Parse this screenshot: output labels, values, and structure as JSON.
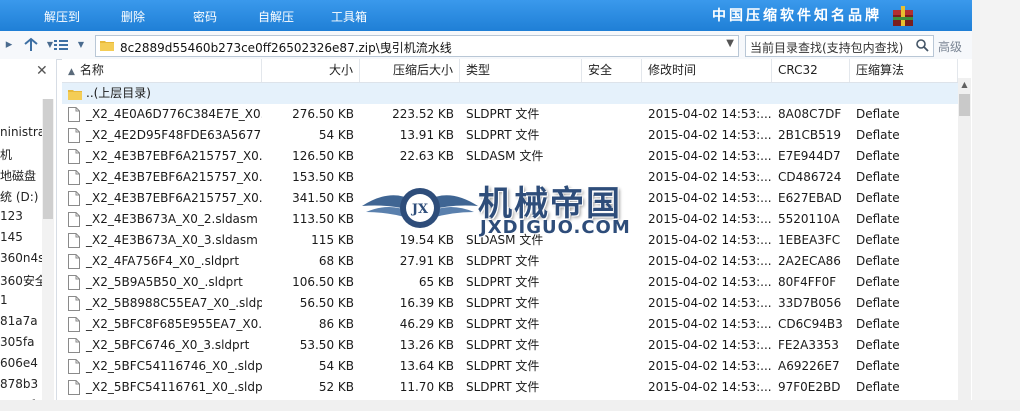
{
  "toolbar": {
    "buttons": [
      "解压到",
      "删除",
      "密码",
      "自解压",
      "工具箱"
    ],
    "brand": "中国压缩软件知名品牌"
  },
  "address": {
    "path": "8c2889d55460b273ce0ff26502326e87.zip\\曳引机流水线",
    "search_placeholder": "当前目录查找(支持包内查找)",
    "advanced": "高级"
  },
  "tree": {
    "items": [
      "ninistrat",
      "机",
      "地磁盘",
      "统 (D:)",
      "123",
      "145",
      "360n4s",
      "360安全",
      "1",
      "81a7a",
      "305fa",
      "606e4",
      "878b3",
      "9898f"
    ]
  },
  "columns": {
    "name": "名称",
    "size": "大小",
    "packed": "压缩后大小",
    "type": "类型",
    "security": "安全",
    "modified": "修改时间",
    "crc": "CRC32",
    "method": "压缩算法"
  },
  "parent_row": "..(上层目录)",
  "files": [
    {
      "name": "_X2_4E0A6D776C384E7E_X0...",
      "size": "276.50 KB",
      "packed": "223.52 KB",
      "type": "SLDPRT 文件",
      "modified": "2015-04-02 14:53:...",
      "crc": "8A08C7DF",
      "method": "Deflate"
    },
    {
      "name": "_X2_4E2D95F48FDE63A5677...",
      "size": "54 KB",
      "packed": "13.91 KB",
      "type": "SLDPRT 文件",
      "modified": "2015-04-02 14:53:...",
      "crc": "2B1CB519",
      "method": "Deflate"
    },
    {
      "name": "_X2_4E3B7EBF6A215757_X0...",
      "size": "126.50 KB",
      "packed": "22.63 KB",
      "type": "SLDASM 文件",
      "modified": "2015-04-02 14:53:...",
      "crc": "E7E944D7",
      "method": "Deflate"
    },
    {
      "name": "_X2_4E3B7EBF6A215757_X0...",
      "size": "153.50 KB",
      "packed": "",
      "type": "",
      "modified": "2015-04-02 14:53:...",
      "crc": "CD486724",
      "method": "Deflate"
    },
    {
      "name": "_X2_4E3B7EBF6A215757_X0...",
      "size": "341.50 KB",
      "packed": "",
      "type": "",
      "modified": "2015-04-02 14:53:...",
      "crc": "E627EBAD",
      "method": "Deflate"
    },
    {
      "name": "_X2_4E3B673A_X0_2.sldasm",
      "size": "113.50 KB",
      "packed": "",
      "type": "",
      "modified": "2015-04-02 14:53:...",
      "crc": "5520110A",
      "method": "Deflate"
    },
    {
      "name": "_X2_4E3B673A_X0_3.sldasm",
      "size": "115 KB",
      "packed": "19.54 KB",
      "type": "SLDASM 文件",
      "modified": "2015-04-02 14:53:...",
      "crc": "1EBEA3FC",
      "method": "Deflate"
    },
    {
      "name": "_X2_4FA756F4_X0_.sldprt",
      "size": "68 KB",
      "packed": "27.91 KB",
      "type": "SLDPRT 文件",
      "modified": "2015-04-02 14:53:...",
      "crc": "2A2ECA86",
      "method": "Deflate"
    },
    {
      "name": "_X2_5B9A5B50_X0_.sldprt",
      "size": "106.50 KB",
      "packed": "65 KB",
      "type": "SLDPRT 文件",
      "modified": "2015-04-02 14:53:...",
      "crc": "80F4FF0F",
      "method": "Deflate"
    },
    {
      "name": "_X2_5B8988C55EA7_X0_.sldprt",
      "size": "56.50 KB",
      "packed": "16.39 KB",
      "type": "SLDPRT 文件",
      "modified": "2015-04-02 14:53:...",
      "crc": "33D7B056",
      "method": "Deflate"
    },
    {
      "name": "_X2_5BFC8F685E955EA7_X0...",
      "size": "86 KB",
      "packed": "46.29 KB",
      "type": "SLDPRT 文件",
      "modified": "2015-04-02 14:53:...",
      "crc": "CD6C94B3",
      "method": "Deflate"
    },
    {
      "name": "_X2_5BFC6746_X0_3.sldprt",
      "size": "53.50 KB",
      "packed": "13.26 KB",
      "type": "SLDPRT 文件",
      "modified": "2015-04-02 14:53:...",
      "crc": "FE2A3353",
      "method": "Deflate"
    },
    {
      "name": "_X2_5BFC54116746_X0_.sldprt",
      "size": "54 KB",
      "packed": "13.64 KB",
      "type": "SLDPRT 文件",
      "modified": "2015-04-02 14:53:...",
      "crc": "A69226E7",
      "method": "Deflate"
    },
    {
      "name": "_X2_5BFC54116761_X0_.sldprt",
      "size": "52 KB",
      "packed": "11.70 KB",
      "type": "SLDPRT 文件",
      "modified": "2015-04-02 14:53:...",
      "crc": "97F0E2BD",
      "method": "Deflate"
    }
  ],
  "watermark": {
    "title": "机械帝国",
    "url": "JXDIGUO.COM",
    "badge": "JX"
  },
  "colors": {
    "toolbar": "#2a8ae0",
    "selection": "#e5f1fb",
    "watermark": "#2e4d7a"
  }
}
